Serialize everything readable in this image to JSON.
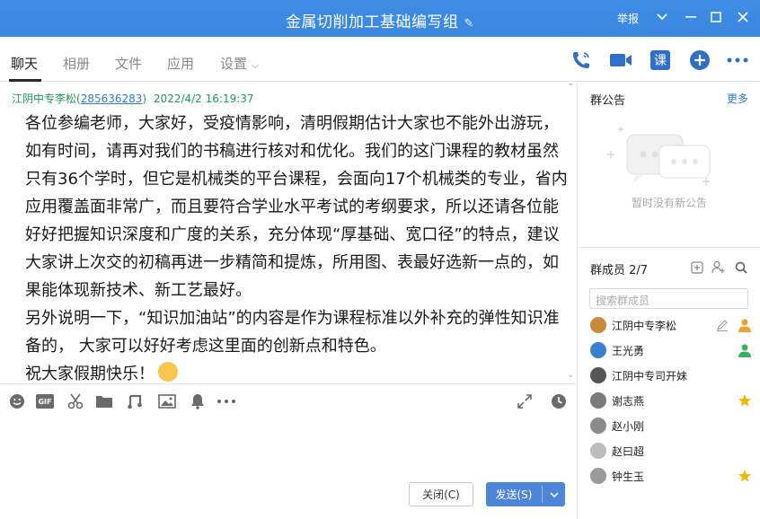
{
  "window": {
    "title": "金属切削加工基础编写组",
    "report_label": "举报"
  },
  "nav": {
    "tabs": [
      {
        "label": "聊天"
      },
      {
        "label": "相册"
      },
      {
        "label": "文件"
      },
      {
        "label": "应用"
      },
      {
        "label": "设置"
      }
    ],
    "class_icon_label": "课"
  },
  "message": {
    "sender_name": "江阴中专李松(",
    "sender_qq": "285636283",
    "sender_close": ")",
    "timestamp": "2022/4/2 16:19:37",
    "paragraph1": "各位参编老师，大家好，受疫情影响，清明假期估计大家也不能外出游玩，如有时间，请再对我们的书稿进行核对和优化。我们的这门课程的教材虽然只有36个学时，但它是机械类的平台课程，会面向17个机械类的专业，省内应用覆盖面非常广，而且要符合学业水平考试的考纲要求，所以还请各位能好好把握知识深度和广度的关系，充分体现“厚基础、宽口径”的特点，建议大家讲上次交的初稿再进一步精简和提炼，所用图、表最好选新一点的，如果能体现新技术、新工艺最好。",
    "paragraph2": "另外说明一下，“知识加油站”的内容是作为课程标准以外补充的弹性知识准备的， 大家可以好好考虑这里面的创新点和特色。",
    "paragraph3": "祝大家假期快乐！"
  },
  "composer": {
    "close_label": "关闭(C)",
    "send_label": "发送(S)"
  },
  "announcement": {
    "title": "群公告",
    "more_label": "更多",
    "empty_text": "暂时没有新公告"
  },
  "members": {
    "title": "群成员 2/7",
    "search_placeholder": "搜索群成员",
    "list": [
      {
        "name": "江阴中专李松",
        "avatar_color": "#c98a3a",
        "role": "owner"
      },
      {
        "name": "王光勇",
        "avatar_color": "#3a7fd0",
        "role": "admin"
      },
      {
        "name": "江阴中专司开妹",
        "avatar_color": "#555555",
        "role": "member"
      },
      {
        "name": "谢志燕",
        "avatar_color": "#7a7a7a",
        "role": "star"
      },
      {
        "name": "赵小刚",
        "avatar_color": "#8a8a8a",
        "role": "member"
      },
      {
        "name": "赵曰超",
        "avatar_color": "#bdbdbd",
        "role": "member"
      },
      {
        "name": "钟生玉",
        "avatar_color": "#9a9a9a",
        "role": "star"
      }
    ]
  },
  "colors": {
    "titlebar": "#3f8de6",
    "accent": "#2a7bd8",
    "send_button": "#4d85d8",
    "sender_green": "#1f9a55",
    "star": "#f2b705",
    "admin_green": "#3fae5a",
    "owner_orange": "#f0a030"
  }
}
